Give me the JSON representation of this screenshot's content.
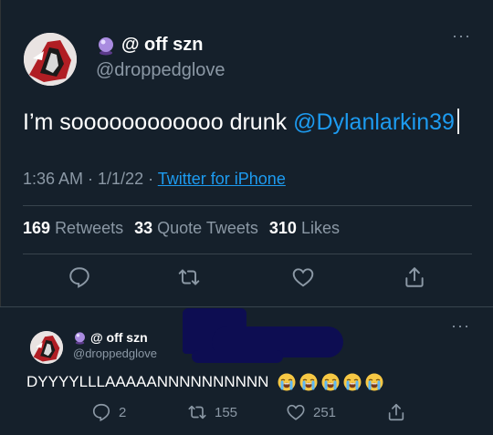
{
  "tweet": {
    "display_name": "@ off szn",
    "handle": "@droppedglove",
    "text": "I’m soooooooooooo drunk",
    "mention": "@Dylanlarkin39",
    "time": "1:36 AM · 1/1/22 ·",
    "source": "Twitter for iPhone",
    "stats": {
      "retweets_count": "169",
      "retweets_label": "Retweets",
      "quotes_count": "33",
      "quotes_label": "Quote Tweets",
      "likes_count": "310",
      "likes_label": "Likes"
    },
    "more_label": "···"
  },
  "reply": {
    "display_name": "@ off szn",
    "handle": "@droppedglove",
    "text": "DYYYYLLLAAAAANNNNNNNNNN",
    "emoji_count": 5,
    "more_label": "···",
    "actions": {
      "reply_count": "2",
      "retweet_count": "155",
      "like_count": "251"
    }
  },
  "colors": {
    "background": "#15202b",
    "link": "#1d9bf0",
    "muted": "#8b98a5",
    "redaction": "#0d0d52"
  },
  "icons": {
    "badge": "crystal-ball-icon",
    "reply": "reply-icon",
    "retweet": "retweet-icon",
    "like": "heart-icon",
    "share": "share-icon",
    "emoji": "loudly-crying-face-emoji"
  }
}
